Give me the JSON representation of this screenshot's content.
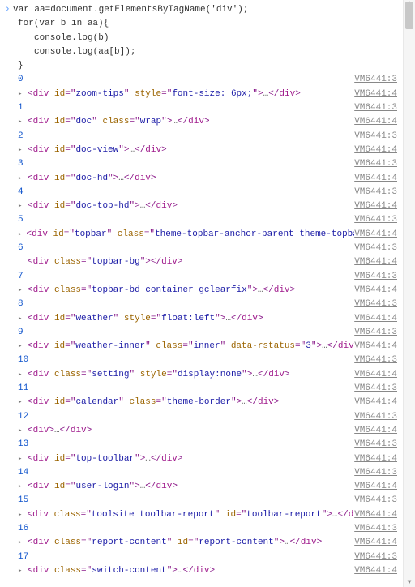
{
  "input": {
    "line1": "var aa=document.getElementsByTagName('div');",
    "line2": "for(var b in aa){",
    "line3": "console.log(b)",
    "line4": "console.log(aa[b]);",
    "line5": "}"
  },
  "source_file": "VM6441",
  "entries": [
    {
      "index": "0",
      "srcA": "VM6441:3",
      "srcB": "VM6441:4",
      "expand": true,
      "parts": [
        {
          "t": "open",
          "v": "div"
        },
        {
          "t": "attr",
          "n": "id",
          "v": "zoom-tips"
        },
        {
          "t": "attr",
          "n": "style",
          "v": "font-size: 6px;"
        },
        {
          "t": "closeOpen"
        },
        {
          "t": "ellipsis"
        },
        {
          "t": "end",
          "v": "div"
        }
      ]
    },
    {
      "index": "1",
      "srcA": "VM6441:3",
      "srcB": "VM6441:4",
      "expand": true,
      "parts": [
        {
          "t": "open",
          "v": "div"
        },
        {
          "t": "attr",
          "n": "id",
          "v": "doc"
        },
        {
          "t": "attr",
          "n": "class",
          "v": "wrap"
        },
        {
          "t": "closeOpen"
        },
        {
          "t": "ellipsis"
        },
        {
          "t": "end",
          "v": "div"
        }
      ]
    },
    {
      "index": "2",
      "srcA": "VM6441:3",
      "srcB": "VM6441:4",
      "expand": true,
      "parts": [
        {
          "t": "open",
          "v": "div"
        },
        {
          "t": "attr",
          "n": "id",
          "v": "doc-view"
        },
        {
          "t": "closeOpen"
        },
        {
          "t": "ellipsis"
        },
        {
          "t": "end",
          "v": "div"
        }
      ]
    },
    {
      "index": "3",
      "srcA": "VM6441:3",
      "srcB": "VM6441:4",
      "expand": true,
      "parts": [
        {
          "t": "open",
          "v": "div"
        },
        {
          "t": "attr",
          "n": "id",
          "v": "doc-hd"
        },
        {
          "t": "closeOpen"
        },
        {
          "t": "ellipsis"
        },
        {
          "t": "end",
          "v": "div"
        }
      ]
    },
    {
      "index": "4",
      "srcA": "VM6441:3",
      "srcB": "VM6441:4",
      "expand": true,
      "parts": [
        {
          "t": "open",
          "v": "div"
        },
        {
          "t": "attr",
          "n": "id",
          "v": "doc-top-hd"
        },
        {
          "t": "closeOpen"
        },
        {
          "t": "ellipsis"
        },
        {
          "t": "end",
          "v": "div"
        }
      ]
    },
    {
      "index": "5",
      "srcA": "VM6441:3",
      "srcB": "VM6441:4",
      "expand": true,
      "parts": [
        {
          "t": "open",
          "v": "div"
        },
        {
          "t": "attr",
          "n": "id",
          "v": "topbar"
        },
        {
          "t": "attr",
          "n": "class",
          "v": "theme-topbar-anchor-parent theme-topbar"
        },
        {
          "t": "closeOpen"
        },
        {
          "t": "ellipsis"
        },
        {
          "t": "end",
          "v": "div"
        }
      ]
    },
    {
      "index": "6",
      "srcA": "VM6441:3",
      "srcB": "VM6441:4",
      "expand": false,
      "parts": [
        {
          "t": "open",
          "v": "div"
        },
        {
          "t": "attr",
          "n": "class",
          "v": "topbar-bg"
        },
        {
          "t": "closeOpen"
        },
        {
          "t": "end",
          "v": "div"
        }
      ]
    },
    {
      "index": "7",
      "srcA": "VM6441:3",
      "srcB": "VM6441:4",
      "expand": true,
      "parts": [
        {
          "t": "open",
          "v": "div"
        },
        {
          "t": "attr",
          "n": "class",
          "v": "topbar-bd container gclearfix"
        },
        {
          "t": "closeOpen"
        },
        {
          "t": "ellipsis"
        },
        {
          "t": "end",
          "v": "div"
        }
      ]
    },
    {
      "index": "8",
      "srcA": "VM6441:3",
      "srcB": "VM6441:4",
      "expand": true,
      "parts": [
        {
          "t": "open",
          "v": "div"
        },
        {
          "t": "attr",
          "n": "id",
          "v": "weather"
        },
        {
          "t": "attr",
          "n": "style",
          "v": "float:left"
        },
        {
          "t": "closeOpen"
        },
        {
          "t": "ellipsis"
        },
        {
          "t": "end",
          "v": "div"
        }
      ]
    },
    {
      "index": "9",
      "srcA": "VM6441:3",
      "srcB": "VM6441:4",
      "expand": true,
      "parts": [
        {
          "t": "open",
          "v": "div"
        },
        {
          "t": "attr",
          "n": "id",
          "v": "weather-inner"
        },
        {
          "t": "attr",
          "n": "class",
          "v": "inner"
        },
        {
          "t": "attr",
          "n": "data-rstatus",
          "v": "3"
        },
        {
          "t": "closeOpen"
        },
        {
          "t": "ellipsis"
        },
        {
          "t": "end",
          "v": "div"
        }
      ]
    },
    {
      "index": "10",
      "srcA": "VM6441:3",
      "srcB": "VM6441:4",
      "expand": true,
      "parts": [
        {
          "t": "open",
          "v": "div"
        },
        {
          "t": "attr",
          "n": "class",
          "v": "setting"
        },
        {
          "t": "attr",
          "n": "style",
          "v": "display:none"
        },
        {
          "t": "closeOpen"
        },
        {
          "t": "ellipsis"
        },
        {
          "t": "end",
          "v": "div"
        }
      ]
    },
    {
      "index": "11",
      "srcA": "VM6441:3",
      "srcB": "VM6441:4",
      "expand": true,
      "parts": [
        {
          "t": "open",
          "v": "div"
        },
        {
          "t": "attr",
          "n": "id",
          "v": "calendar"
        },
        {
          "t": "attr",
          "n": "class",
          "v": "theme-border"
        },
        {
          "t": "closeOpen"
        },
        {
          "t": "ellipsis"
        },
        {
          "t": "end",
          "v": "div"
        }
      ]
    },
    {
      "index": "12",
      "srcA": "VM6441:3",
      "srcB": "VM6441:4",
      "expand": true,
      "parts": [
        {
          "t": "open",
          "v": "div"
        },
        {
          "t": "closeOpen"
        },
        {
          "t": "ellipsis"
        },
        {
          "t": "end",
          "v": "div"
        }
      ]
    },
    {
      "index": "13",
      "srcA": "VM6441:3",
      "srcB": "VM6441:4",
      "expand": true,
      "parts": [
        {
          "t": "open",
          "v": "div"
        },
        {
          "t": "attr",
          "n": "id",
          "v": "top-toolbar"
        },
        {
          "t": "closeOpen"
        },
        {
          "t": "ellipsis"
        },
        {
          "t": "end",
          "v": "div"
        }
      ]
    },
    {
      "index": "14",
      "srcA": "VM6441:3",
      "srcB": "VM6441:4",
      "expand": true,
      "parts": [
        {
          "t": "open",
          "v": "div"
        },
        {
          "t": "attr",
          "n": "id",
          "v": "user-login"
        },
        {
          "t": "closeOpen"
        },
        {
          "t": "ellipsis"
        },
        {
          "t": "end",
          "v": "div"
        }
      ]
    },
    {
      "index": "15",
      "srcA": "VM6441:3",
      "srcB": "VM6441:4",
      "expand": true,
      "parts": [
        {
          "t": "open",
          "v": "div"
        },
        {
          "t": "attr",
          "n": "class",
          "v": "toolsite toolbar-report"
        },
        {
          "t": "attr",
          "n": "id",
          "v": "toolbar-report"
        },
        {
          "t": "closeOpen"
        },
        {
          "t": "ellipsis"
        },
        {
          "t": "end",
          "v": "div"
        }
      ]
    },
    {
      "index": "16",
      "srcA": "VM6441:3",
      "srcB": "VM6441:4",
      "expand": true,
      "parts": [
        {
          "t": "open",
          "v": "div"
        },
        {
          "t": "attr",
          "n": "class",
          "v": "report-content"
        },
        {
          "t": "attr",
          "n": "id",
          "v": "report-content"
        },
        {
          "t": "closeOpen"
        },
        {
          "t": "ellipsis"
        },
        {
          "t": "end",
          "v": "div"
        }
      ]
    },
    {
      "index": "17",
      "srcA": "VM6441:3",
      "srcB": "VM6441:4",
      "expand": true,
      "parts": [
        {
          "t": "open",
          "v": "div"
        },
        {
          "t": "attr",
          "n": "class",
          "v": "switch-content"
        },
        {
          "t": "closeOpen"
        },
        {
          "t": "ellipsis"
        },
        {
          "t": "end",
          "v": "div"
        }
      ]
    }
  ]
}
